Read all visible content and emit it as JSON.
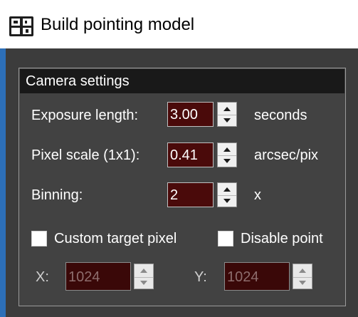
{
  "window": {
    "title": "Build pointing model",
    "icon": "pointing-model-app-icon"
  },
  "camera_settings": {
    "title": "Camera settings",
    "exposure": {
      "label": "Exposure length:",
      "value": "3.00",
      "unit": "seconds"
    },
    "pixel_scale": {
      "label": "Pixel scale (1x1):",
      "value": "0.41",
      "unit": "arcsec/pix"
    },
    "binning": {
      "label": "Binning:",
      "value": "2",
      "unit": "x"
    },
    "custom_target_pixel": {
      "label": "Custom target pixel",
      "checked": false
    },
    "disable_point": {
      "label": "Disable point",
      "checked": false
    },
    "target_x": {
      "label": "X:",
      "value": "1024",
      "enabled": false
    },
    "target_y": {
      "label": "Y:",
      "value": "1024",
      "enabled": false
    }
  },
  "colors": {
    "input_background": "#4a0a0a",
    "panel_background": "#3c3c3c",
    "group_header": "#191919",
    "window_border": "#2d6fb8"
  }
}
